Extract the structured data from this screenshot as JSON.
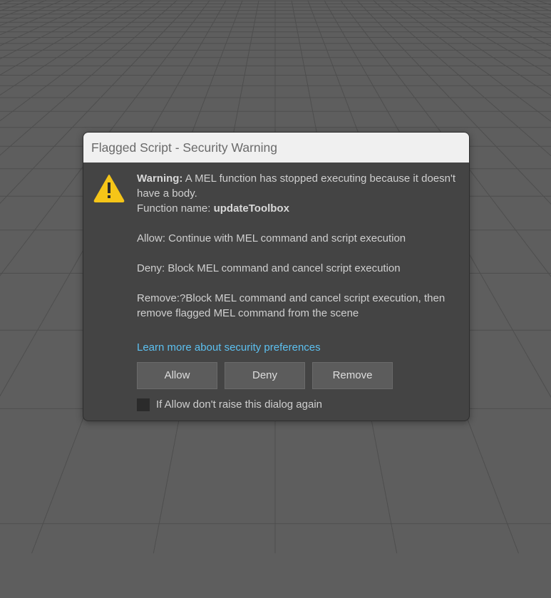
{
  "dialog": {
    "title": "Flagged Script - Security Warning",
    "warning_label": "Warning:",
    "warning_text": " A MEL function has stopped executing because it doesn't have a body.",
    "function_name_label": "Function name: ",
    "function_name": "updateToolbox",
    "allow_desc": "Allow: Continue with MEL command and script execution",
    "deny_desc": "Deny: Block MEL command and cancel script execution",
    "remove_desc": "Remove:?Block MEL command and cancel script execution, then remove flagged MEL command from the scene",
    "learn_more_link": "Learn more about security preferences",
    "buttons": {
      "allow": "Allow",
      "deny": "Deny",
      "remove": "Remove"
    },
    "checkbox": {
      "label": "If Allow don't raise this dialog again",
      "checked": false
    },
    "icon": "warning-triangle-icon"
  },
  "colors": {
    "dialog_bg": "#444444",
    "titlebar_bg": "#f0f0f0",
    "link": "#5cc0f0",
    "warning_icon": "#f5c518",
    "viewport_bg": "#5e5e5e",
    "grid_line": "#4e4e4e"
  }
}
